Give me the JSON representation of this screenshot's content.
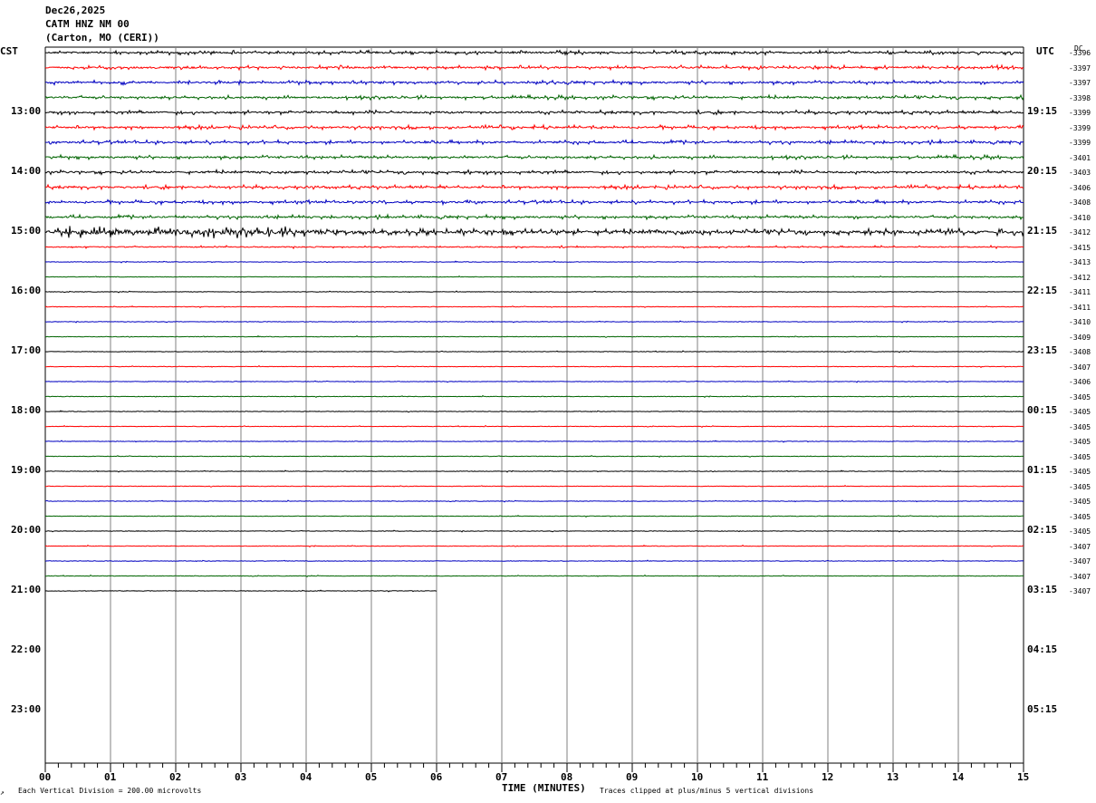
{
  "header": {
    "date": "Dec26,2025",
    "station": "CATM HNZ NM 00",
    "location": "(Carton, MO (CERI))"
  },
  "left_zone": "CST",
  "right_zone": "UTC",
  "dc_label": "DC",
  "footer": {
    "scale": "Each Vertical Division =  200.00 microvolts",
    "xlabel": "TIME (MINUTES)",
    "clip_note": "Traces clipped at plus/minus 5 vertical divisions"
  },
  "colors": {
    "black": "#000000",
    "red": "#ff0000",
    "blue": "#0000c0",
    "green": "#006400",
    "grid": "#808080"
  },
  "chart_data": {
    "type": "line",
    "title": "CATM HNZ NM 00",
    "xlabel": "TIME (MINUTES)",
    "xlim": [
      0,
      15
    ],
    "x_ticks": [
      "00",
      "01",
      "02",
      "03",
      "04",
      "05",
      "06",
      "07",
      "08",
      "09",
      "10",
      "11",
      "12",
      "13",
      "14",
      "15"
    ],
    "left_time_labels": [
      "13:00",
      "14:00",
      "15:00",
      "16:00",
      "17:00",
      "18:00",
      "19:00",
      "20:00",
      "21:00",
      "22:00",
      "23:00"
    ],
    "right_time_labels": [
      "19:15",
      "20:15",
      "21:15",
      "22:15",
      "23:15",
      "00:15",
      "01:15",
      "02:15",
      "03:15",
      "04:15",
      "05:15"
    ],
    "trace_count": 37,
    "last_trace_end_minute": 6,
    "trace_color_cycle": [
      "black",
      "red",
      "blue",
      "green"
    ],
    "dc_offsets": [
      "-3396",
      "-3397",
      "-3397",
      "-3398",
      "-3399",
      "-3399",
      "-3399",
      "-3401",
      "-3403",
      "-3406",
      "-3408",
      "-3410",
      "-3412",
      "-3415",
      "-3413",
      "-3412",
      "-3411",
      "-3411",
      "-3410",
      "-3409",
      "-3408",
      "-3407",
      "-3406",
      "-3405",
      "-3405",
      "-3405",
      "-3405",
      "-3405",
      "-3405",
      "-3405",
      "-3405",
      "-3405",
      "-3405",
      "-3407",
      "-3407",
      "-3407",
      "-3407"
    ],
    "activity": [
      "high",
      "high",
      "high",
      "high",
      "high",
      "high",
      "high",
      "high",
      "high",
      "high",
      "high",
      "high",
      "burst",
      "med",
      "low",
      "low",
      "low",
      "low",
      "low",
      "low",
      "low",
      "low",
      "low",
      "low",
      "low",
      "low",
      "low",
      "low",
      "low",
      "low",
      "low",
      "low",
      "low",
      "low",
      "low",
      "low",
      "low"
    ]
  }
}
